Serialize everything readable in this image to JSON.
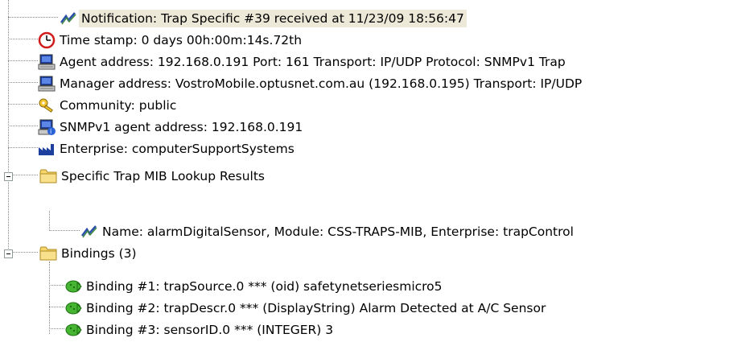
{
  "tree": {
    "items": [
      {
        "label": "Notification: Trap Specific #39 received at 11/23/09 18:56:47",
        "icon": "trap-notification-icon"
      },
      {
        "label": "Time stamp: 0 days 00h:00m:14s.72th",
        "icon": "clock-icon"
      },
      {
        "label": "Agent address: 192.168.0.191 Port: 161 Transport: IP/UDP Protocol: SNMPv1 Trap",
        "icon": "computer-icon"
      },
      {
        "label": "Manager address: VostroMobile.optusnet.com.au (192.168.0.195) Transport: IP/UDP",
        "icon": "computer-icon"
      },
      {
        "label": "Community: public",
        "icon": "key-icon"
      },
      {
        "label": "SNMPv1 agent address: 192.168.0.191",
        "icon": "agent-computer-icon"
      },
      {
        "label": "Enterprise: computerSupportSystems",
        "icon": "factory-icon"
      },
      {
        "label": "Specific Trap MIB Lookup Results",
        "icon": "folder-icon"
      },
      {
        "label": "Name: alarmDigitalSensor, Module: CSS-TRAPS-MIB, Enterprise: trapControl",
        "icon": "trap-notification-icon"
      },
      {
        "label": "Bindings (3)",
        "icon": "folder-icon"
      },
      {
        "label": "Binding #1: trapSource.0 *** (oid) safetynetseriesmicro5",
        "icon": "binding-icon"
      },
      {
        "label": "Binding #2: trapDescr.0 *** (DisplayString) Alarm Detected at A/C Sensor",
        "icon": "binding-icon"
      },
      {
        "label": "Binding #3: sensorID.0 *** (INTEGER) 3",
        "icon": "binding-icon"
      }
    ]
  }
}
